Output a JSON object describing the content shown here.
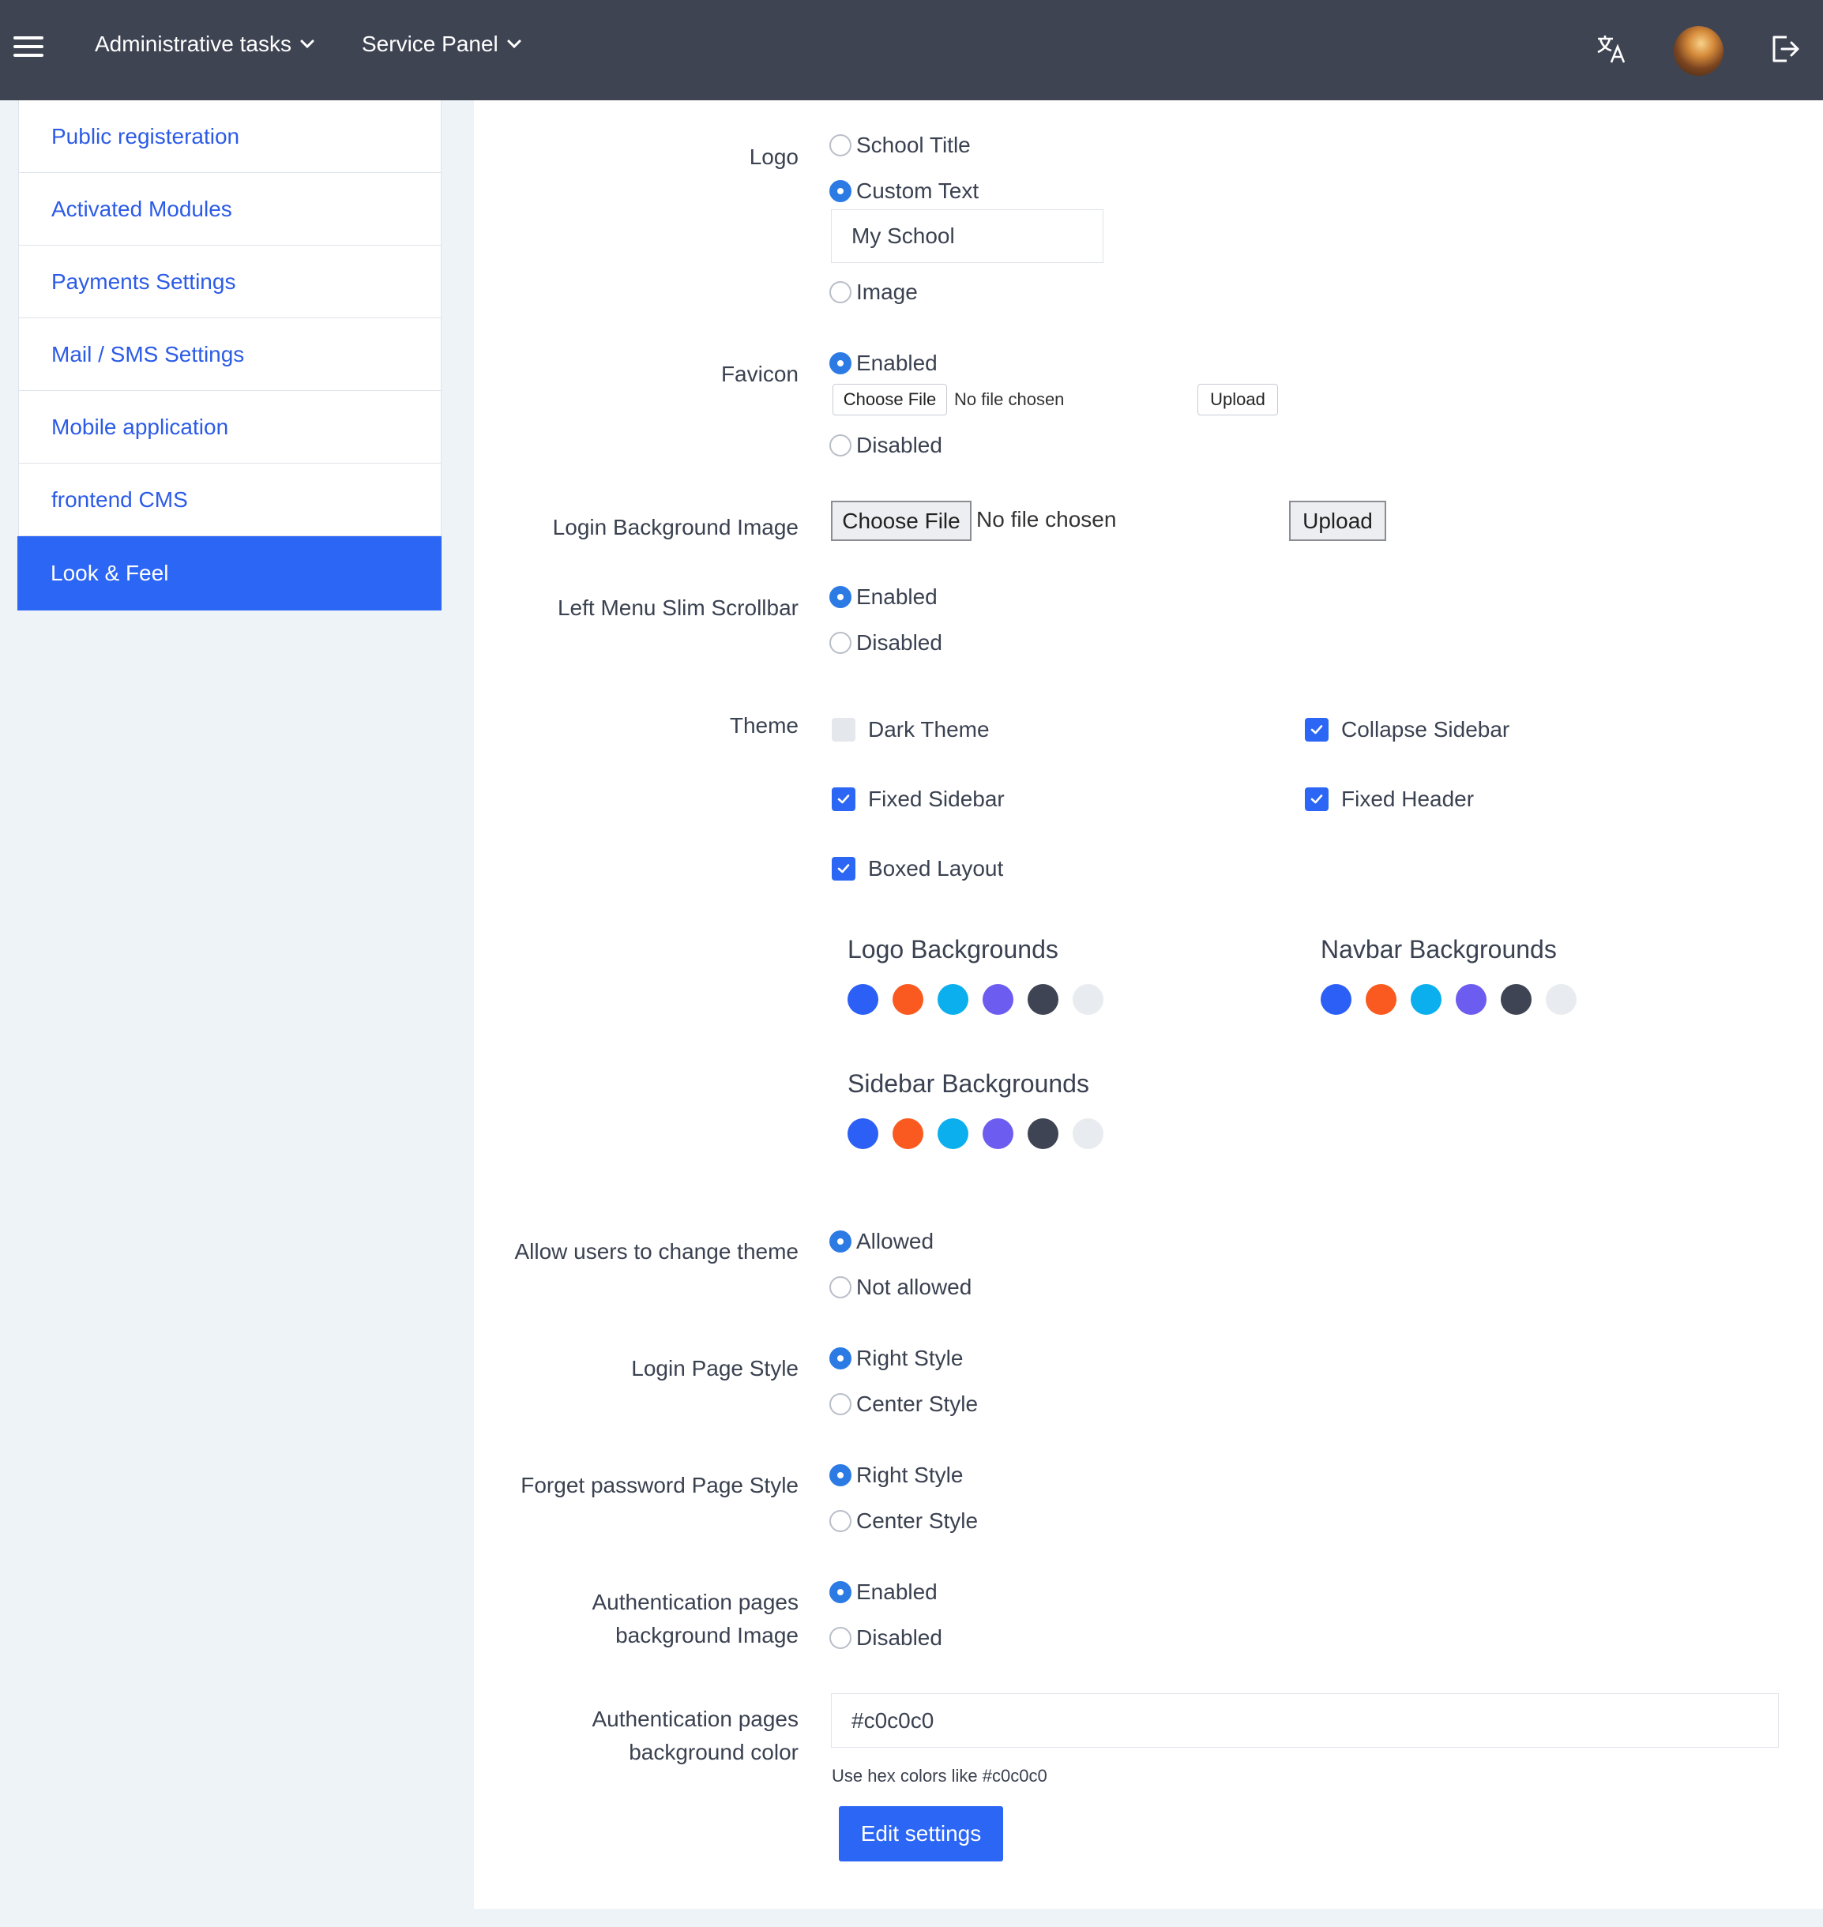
{
  "navbar": {
    "menu_admin": "Administrative tasks",
    "menu_service": "Service Panel",
    "icons": [
      "hamburger-icon",
      "translate-icon",
      "avatar",
      "logout-icon"
    ]
  },
  "sidebar": {
    "items": [
      {
        "label": "Public registeration",
        "active": false
      },
      {
        "label": "Activated Modules",
        "active": false
      },
      {
        "label": "Payments Settings",
        "active": false
      },
      {
        "label": "Mail / SMS Settings",
        "active": false
      },
      {
        "label": "Mobile application",
        "active": false
      },
      {
        "label": "frontend CMS",
        "active": false
      },
      {
        "label": "Look & Feel",
        "active": true
      }
    ]
  },
  "form": {
    "logo": {
      "label": "Logo",
      "opt_school_title": "School Title",
      "opt_custom_text": "Custom Text",
      "custom_text_value": "My School",
      "opt_image": "Image",
      "selected": "Custom Text"
    },
    "favicon": {
      "label": "Favicon",
      "opt_enabled": "Enabled",
      "opt_disabled": "Disabled",
      "choose_file": "Choose File",
      "no_file": "No file chosen",
      "upload": "Upload",
      "selected": "Enabled"
    },
    "login_bg": {
      "label": "Login Background Image",
      "choose_file": "Choose File",
      "no_file": "No file chosen",
      "upload": "Upload"
    },
    "slim_scrollbar": {
      "label": "Left Menu Slim Scrollbar",
      "opt_enabled": "Enabled",
      "opt_disabled": "Disabled",
      "selected": "Enabled"
    },
    "theme": {
      "label": "Theme",
      "dark_theme": {
        "label": "Dark Theme",
        "checked": false
      },
      "collapse_sidebar": {
        "label": "Collapse Sidebar",
        "checked": true
      },
      "fixed_sidebar": {
        "label": "Fixed Sidebar",
        "checked": true
      },
      "fixed_header": {
        "label": "Fixed Header",
        "checked": true
      },
      "boxed_layout": {
        "label": "Boxed Layout",
        "checked": true
      },
      "logo_backgrounds": "Logo Backgrounds",
      "navbar_backgrounds": "Navbar Backgrounds",
      "sidebar_backgrounds": "Sidebar Backgrounds",
      "swatch_colors": [
        "#2c5ff5",
        "#fa5a20",
        "#0bafee",
        "#6d5cf0",
        "#3e4453",
        "#e8ebef"
      ]
    },
    "allow_change_theme": {
      "label": "Allow users to change theme",
      "opt_allowed": "Allowed",
      "opt_not_allowed": "Not allowed",
      "selected": "Allowed"
    },
    "login_style": {
      "label": "Login Page Style",
      "opt_right": "Right Style",
      "opt_center": "Center Style",
      "selected": "Right Style"
    },
    "forget_style": {
      "label": "Forget password Page Style",
      "opt_right": "Right Style",
      "opt_center": "Center Style",
      "selected": "Right Style"
    },
    "auth_bg_image": {
      "label_line1": "Authentication pages",
      "label_line2": "background Image",
      "opt_enabled": "Enabled",
      "opt_disabled": "Disabled",
      "selected": "Enabled"
    },
    "auth_bg_color": {
      "label_line1": "Authentication pages",
      "label_line2": "background color",
      "value": "#c0c0c0",
      "hint": "Use hex colors like #c0c0c0"
    },
    "submit": "Edit settings"
  },
  "colors": {
    "navbar_bg": "#3f4452",
    "accent": "#2c66f5",
    "link": "#2c5be6",
    "page_bg": "#eef3f8"
  }
}
